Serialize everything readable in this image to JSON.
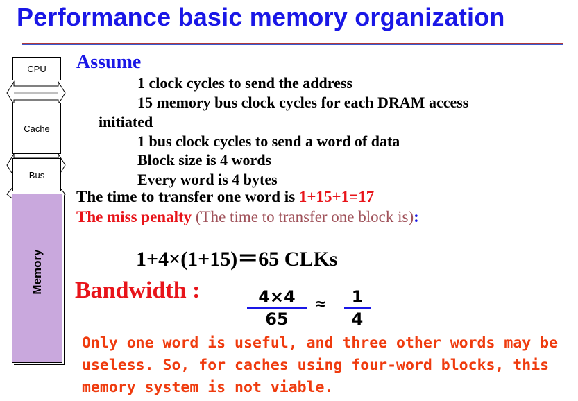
{
  "title": "Performance basic memory organization",
  "diagram": {
    "cpu": "CPU",
    "cache": "Cache",
    "bus": "Bus",
    "memory": "Memory"
  },
  "assume": {
    "heading": "Assume",
    "line1": "1  clock cycles to send the address",
    "line2a": "15 memory bus clock cycles for each DRAM  access",
    "line2b": "initiated",
    "line3": "1 bus clock cycles to send a word of data",
    "line4": "Block size is 4 words",
    "line5": "Every word is 4 bytes"
  },
  "transfer": {
    "text": "The time to transfer one word is ",
    "value": "1+15+1=17"
  },
  "miss": {
    "label": "The miss penalty",
    "paren": " (The time to transfer one block is)",
    "colon": ":"
  },
  "formula": "1+4×(1+15)＝65 CLKs",
  "bandwidth": {
    "label": "Bandwidth :",
    "num1": "4×4",
    "den1": "65",
    "approx": "≈",
    "num2": "1",
    "den2": "4"
  },
  "note": "Only one word is useful, and three other words may be useless. So, for caches using four-word blocks, this memory system is not viable.",
  "colors": {
    "title": "#1a17e6",
    "red": "#e8141a",
    "note": "#ef3b0e",
    "memory": "#c9a8dd"
  }
}
